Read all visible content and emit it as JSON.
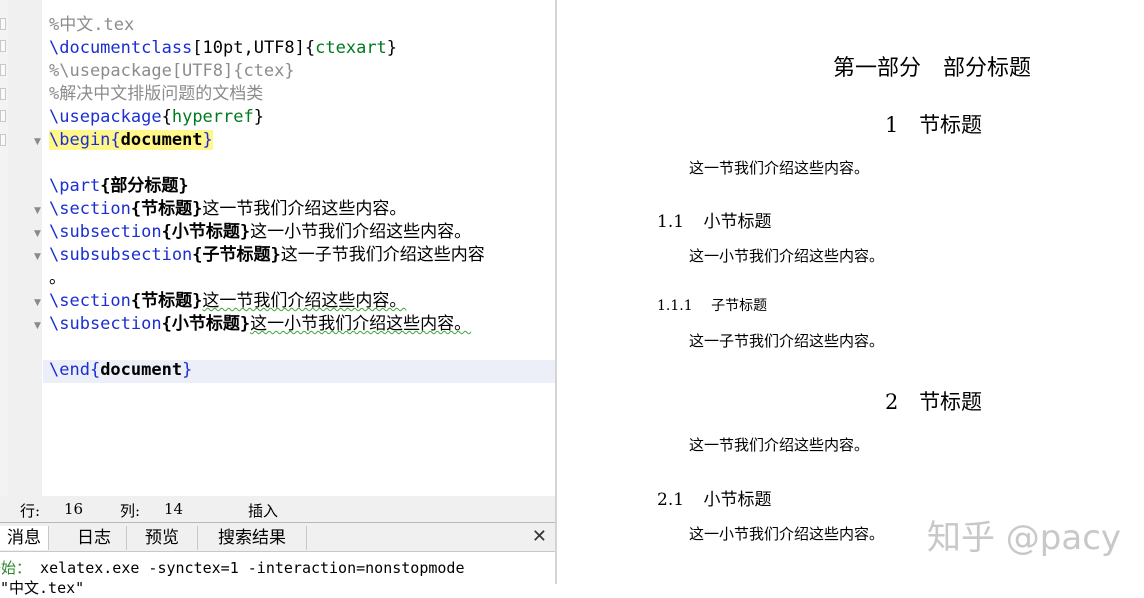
{
  "editor": {
    "lines": [
      {
        "segments": [
          {
            "text": "%中文.tex",
            "style": "cmt"
          }
        ]
      },
      {
        "segments": [
          {
            "text": "\\documentclass",
            "style": "cmd"
          },
          {
            "text": "[10pt,UTF8]",
            "style": "plain"
          },
          {
            "text": "{",
            "style": "plain"
          },
          {
            "text": "ctexart",
            "style": "arg"
          },
          {
            "text": "}",
            "style": "plain"
          }
        ]
      },
      {
        "segments": [
          {
            "text": "%\\usepackage[UTF8]{ctex}",
            "style": "cmt"
          }
        ]
      },
      {
        "segments": [
          {
            "text": "%解决中文排版问题的文档类",
            "style": "cmt"
          }
        ]
      },
      {
        "segments": [
          {
            "text": "\\usepackage",
            "style": "cmd"
          },
          {
            "text": "{",
            "style": "plain"
          },
          {
            "text": "hyperref",
            "style": "arg"
          },
          {
            "text": "}",
            "style": "plain"
          }
        ]
      },
      {
        "segments": [
          {
            "text": "\\begin{",
            "style": "cmd-hl"
          },
          {
            "text": "document",
            "style": "bold-hl"
          },
          {
            "text": "}",
            "style": "cmd-hl"
          }
        ]
      },
      {
        "segments": []
      },
      {
        "segments": [
          {
            "text": "\\part",
            "style": "cmd"
          },
          {
            "text": "{部分标题}",
            "style": "bold"
          }
        ]
      },
      {
        "segments": [
          {
            "text": "\\section",
            "style": "cmd"
          },
          {
            "text": "{节标题}",
            "style": "bold"
          },
          {
            "text": "这一节我们介绍这些内容。",
            "style": "plain"
          }
        ]
      },
      {
        "segments": [
          {
            "text": "\\subsection",
            "style": "cmd"
          },
          {
            "text": "{小节标题}",
            "style": "bold"
          },
          {
            "text": "这一小节我们介绍这些内容。",
            "style": "plain"
          }
        ]
      },
      {
        "segments": [
          {
            "text": "\\subsubsection",
            "style": "cmd"
          },
          {
            "text": "{子节标题}",
            "style": "bold"
          },
          {
            "text": "这一子节我们介绍这些内容",
            "style": "plain"
          }
        ]
      },
      {
        "segments": [
          {
            "text": "。",
            "style": "plain"
          }
        ]
      },
      {
        "segments": [
          {
            "text": "\\section",
            "style": "cmd"
          },
          {
            "text": "{节标题}",
            "style": "bold"
          },
          {
            "text": "这一节我们介绍这些内容。",
            "style": "squiggle"
          }
        ]
      },
      {
        "segments": [
          {
            "text": "\\subsection",
            "style": "cmd"
          },
          {
            "text": "{小节标题}",
            "style": "bold"
          },
          {
            "text": "这一小节我们介绍这些内容。",
            "style": "squiggle"
          }
        ]
      },
      {
        "segments": []
      },
      {
        "segments": [
          {
            "text": "\\end{",
            "style": "cmd"
          },
          {
            "text": "document",
            "style": "bold"
          },
          {
            "text": "}",
            "style": "cmd"
          }
        ]
      }
    ]
  },
  "status": {
    "row_label": "行:",
    "row_value": "16",
    "col_label": "列:",
    "col_value": "14",
    "mode": "插入"
  },
  "messages": {
    "tabs": [
      "消息",
      "日志",
      "预览",
      "搜索结果"
    ],
    "active_tab": 0,
    "close_glyph": "✕",
    "log_prefix": "开始：",
    "log_command": "xelatex.exe -synctex=1 -interaction=nonstopmode",
    "log_line2": "  \"中文.tex\""
  },
  "preview": {
    "part_title": "第一部分　部分标题",
    "sections": [
      {
        "number": "1",
        "title": "节标题",
        "body": "这一节我们介绍这些内容。"
      },
      {
        "number": "1.1",
        "title": "小节标题",
        "body": "这一小节我们介绍这些内容。"
      },
      {
        "number": "1.1.1",
        "title": "子节标题",
        "body": "这一子节我们介绍这些内容。"
      },
      {
        "number": "2",
        "title": "节标题",
        "body": "这一节我们介绍这些内容。"
      },
      {
        "number": "2.1",
        "title": "小节标题",
        "body": "这一小节我们介绍这些内容。"
      }
    ]
  },
  "watermark": "知乎 @pacy",
  "colors": {
    "command": "#1a2fd1",
    "argument": "#007a1f",
    "comment": "#8c8c8c",
    "highlight": "#fff78a",
    "current_line": "#eceef8"
  }
}
